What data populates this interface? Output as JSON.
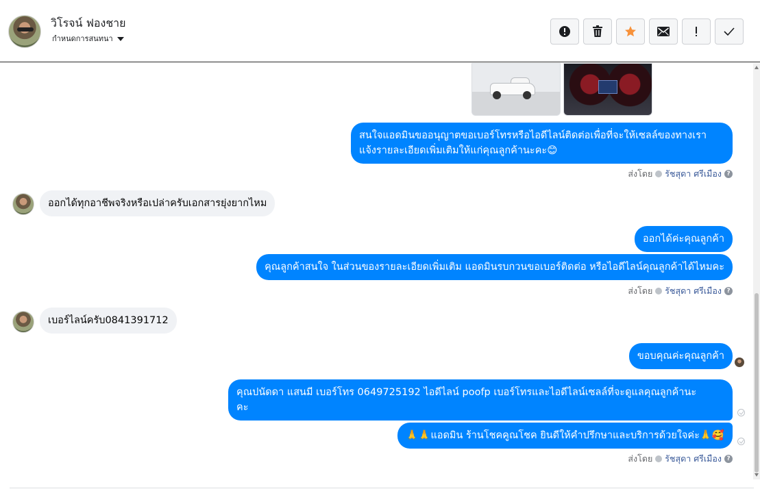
{
  "header": {
    "contact_name": "วิโรจน์ ฟองชาย",
    "conversation_settings": "กำหนดการสนทนา",
    "actions": [
      {
        "name": "report-spam",
        "icon": "alert-circle-icon"
      },
      {
        "name": "delete",
        "icon": "trash-icon"
      },
      {
        "name": "star",
        "icon": "star-icon",
        "color": "#f7923b"
      },
      {
        "name": "mark-unread",
        "icon": "envelope-icon"
      },
      {
        "name": "follow-up",
        "icon": "exclamation-icon"
      },
      {
        "name": "mark-done",
        "icon": "check-icon"
      }
    ]
  },
  "messages": {
    "m1": "สนใจแอดมินขออนุญาตขอเบอร์โทรหรือไอดีไลน์ติดต่อเพื่อที่จะให้เซลล์ของทางเรา",
    "m1b": "แจ้งรายละเอียดเพิ่มเติมให้แก่คุณลูกค้านะคะ😊",
    "m2": "ออกได้ทุกอาชีพจริงหรือเปล่าครับเอกสารยุ่งยากไหม",
    "m3": "ออกได้ค่ะคุณลูกค้า",
    "m4": "คุณลูกค้าสนใจ ในส่วนของรายละเอียดเพิ่มเติม แอดมินรบกวนขอเบอร์ติดต่อ หรือไอดีไลน์คุณลูกค้าได้ไหมคะ",
    "m5": "เบอร์ไลน์ครับ0841391712",
    "m6": "ขอบคุณค่ะคุณลูกค้า",
    "m7": "คุณปนัดดา แสนมี   เบอร์โทร 0649725192  ไอดีไลน์ poofp   เบอร์โทรและไอดีไลน์เซลล์ที่จะดูแลคุณลูกค้านะ",
    "m7b": "คะ",
    "m8": "🙏🙏แอดมิน ร้านโชคคูณโชค ยินดีให้คำปรึกษาและบริการด้วยใจค่ะ🙏🥰"
  },
  "sent_by": {
    "label": "ส่งโดย",
    "agent": "รัชสุดา ศรีเมือง",
    "help": "?"
  },
  "colors": {
    "outgoing_bubble": "#0084ff",
    "incoming_bubble": "#f0f2f5"
  }
}
